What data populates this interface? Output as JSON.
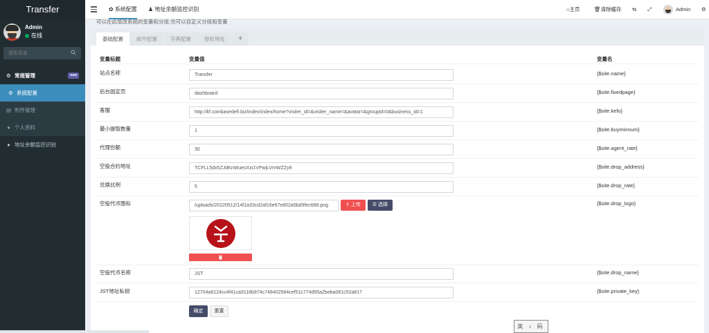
{
  "sidebar": {
    "brand": "Transfer",
    "user": {
      "name": "Admin",
      "status": "在线"
    },
    "search_placeholder": "搜索菜单",
    "menu": [
      {
        "label": "常规管理",
        "icon": "cogs-icon",
        "badge": "new"
      },
      {
        "label": "系统配置",
        "icon": "gear-icon"
      },
      {
        "label": "附件管理",
        "icon": "file-image-icon"
      },
      {
        "label": "个人资料",
        "icon": "user-icon"
      },
      {
        "label": "地址余额监控识别",
        "icon": "users-icon"
      }
    ]
  },
  "topbar": {
    "tabs": [
      {
        "label": "系统配置",
        "icon": "gear-icon"
      },
      {
        "label": "地址余额监控识别",
        "icon": "users-icon"
      }
    ],
    "right": {
      "home": "主页",
      "clear_cache": "清除缓存",
      "user": "Admin"
    }
  },
  "content": {
    "intro": "可以在此增改系统的变量和分组,也可以自定义分组和变量",
    "tabs": [
      "基础配置",
      "邮件配置",
      "字典配置",
      "授权地址",
      "+"
    ],
    "headers": {
      "title": "变量标题",
      "value": "变量值",
      "name": "变量名"
    },
    "rows": [
      {
        "title": "站点名称",
        "value": "Transfer",
        "name": "{$site.name}"
      },
      {
        "title": "后台固定页",
        "value": "dashboard",
        "name": "{$site.fixedpage}"
      },
      {
        "title": "客服",
        "value": "http://kf.coinbasedefi.biz/index/index/home?visiter_id=&visiter_name=&avatar=&groupid=0&business_id=1",
        "name": "{$site.kefu}"
      },
      {
        "title": "最小提取数量",
        "value": "1",
        "name": "{$site.buyminnum}"
      },
      {
        "title": "代理份额",
        "value": "30",
        "name": "{$site.agent_rate}"
      },
      {
        "title": "空投合约地址",
        "value": "TCFLL5dx5ZJdKnWuesXxi1VPwjLVmWZZy9",
        "name": "{$site.drop_address}"
      },
      {
        "title": "兑换比例",
        "value": "5",
        "name": "{$site.drop_rate}"
      },
      {
        "title": "空投代币图标",
        "value": "/uploads/20220512/14f1a33cd2af16e67e802a5bd9fec688.png",
        "name": "{$site.drop_logo}"
      },
      {
        "title": "空投代币名称",
        "value": "JST",
        "name": "{$site.drop_name}"
      },
      {
        "title": "JST地址私钥",
        "value": "12704a9124cc4f41ca9118b974c748402584cef51c774d95a2beba081c52a817",
        "name": "{$site.private_key}"
      }
    ],
    "upload_label": "上传",
    "choose_label": "选择",
    "submit_label": "确定",
    "reset_label": "重置"
  },
  "stamp": "英 ♪ 码",
  "colors": {
    "sidebar": "#222d32",
    "accent": "#3c8dbc",
    "danger": "#f05050",
    "dark_button": "#444c69"
  }
}
